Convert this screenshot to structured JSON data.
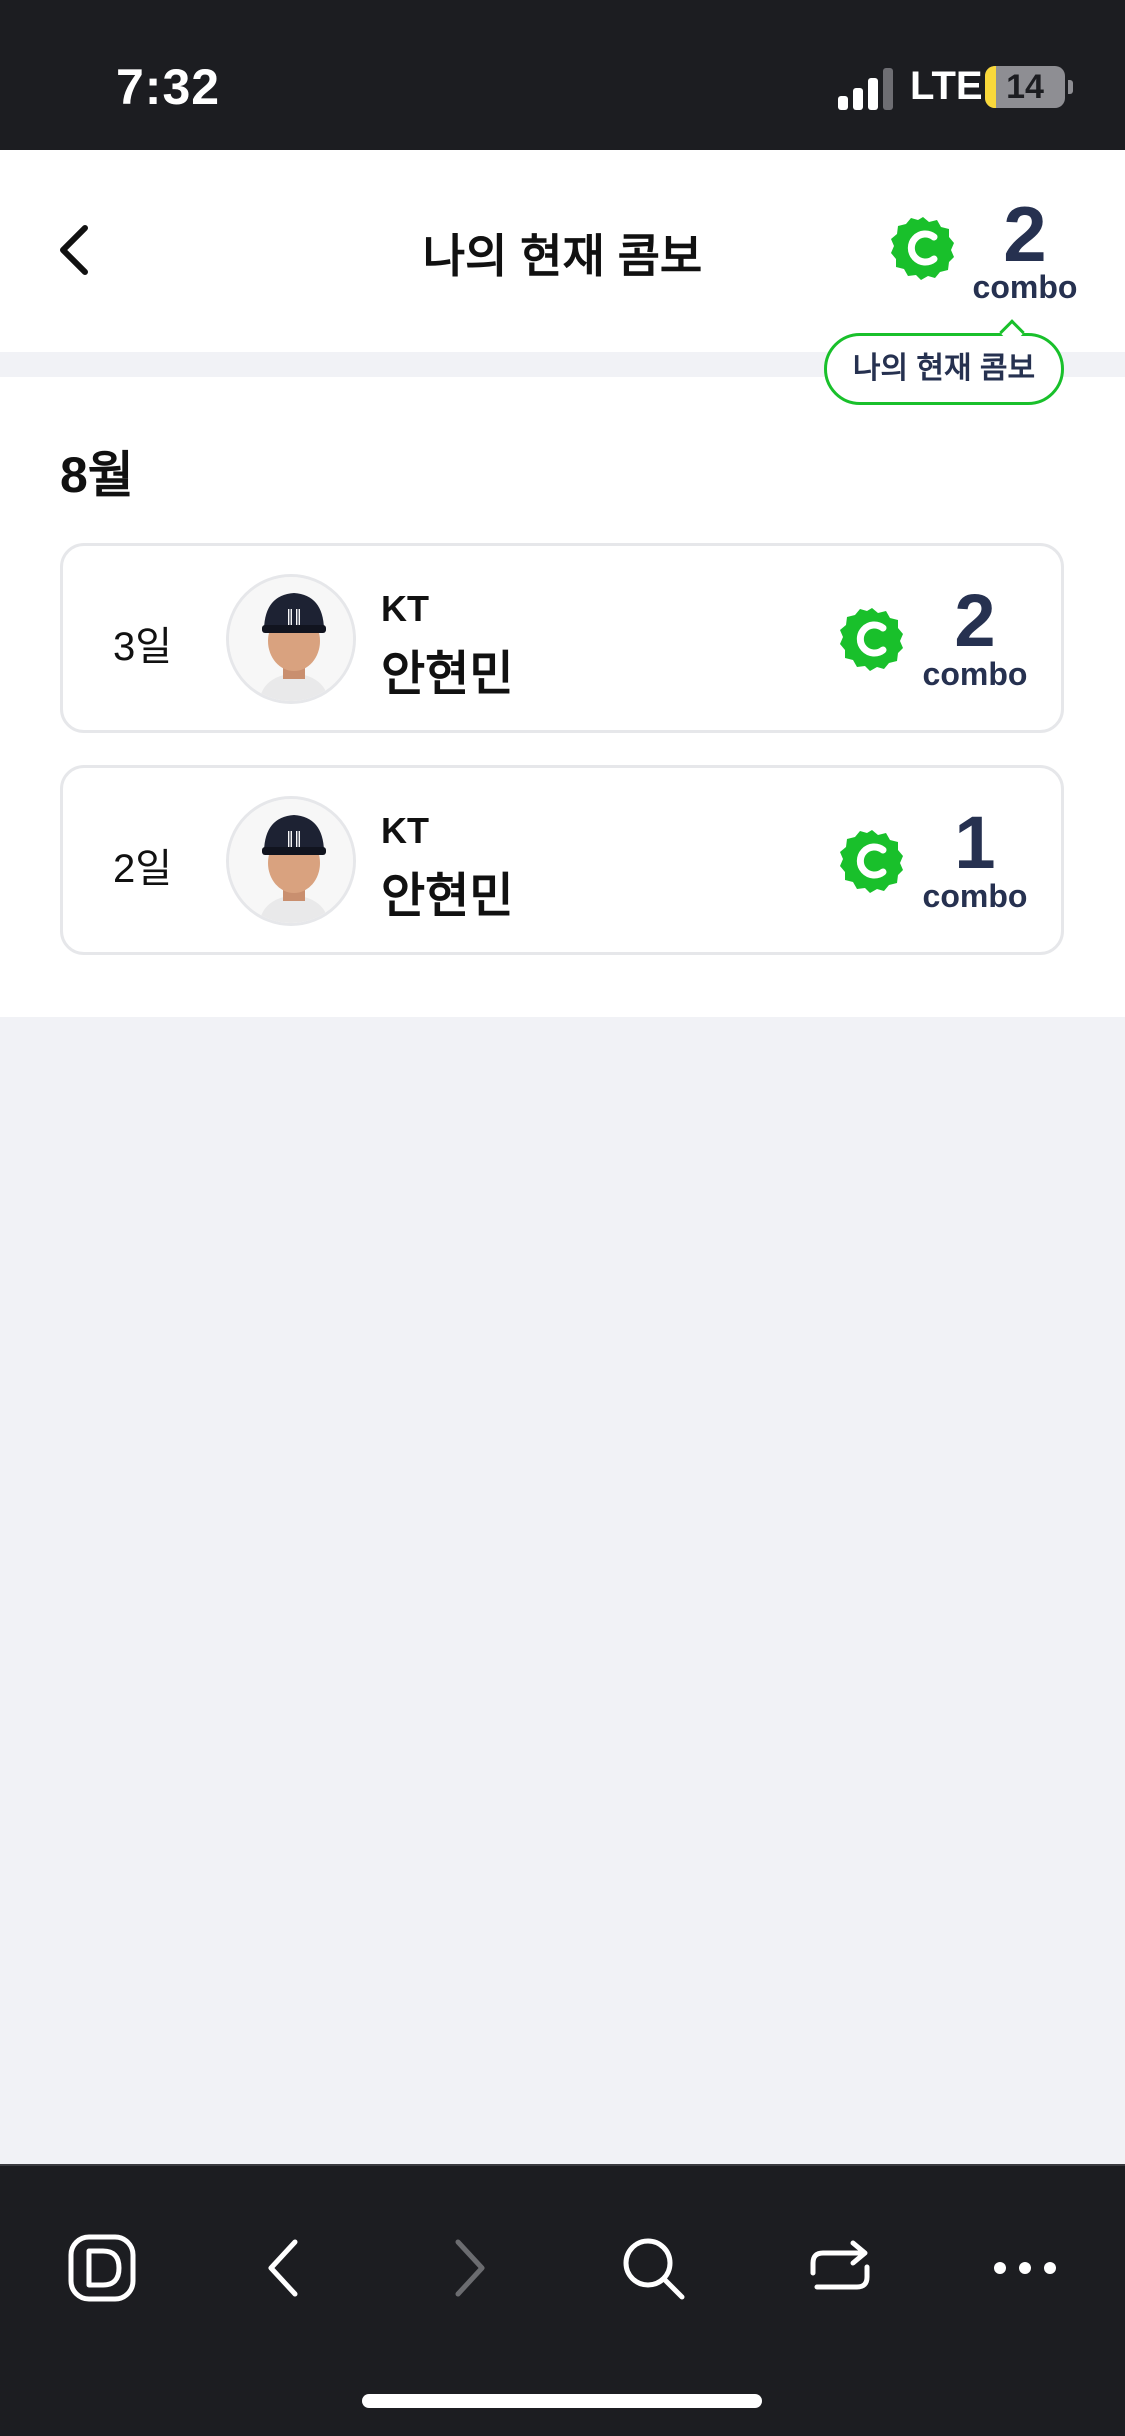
{
  "status_bar": {
    "time": "7:32",
    "network": "LTE",
    "battery_level": "14",
    "battery_fraction": 0.14
  },
  "header": {
    "title": "나의 현재 콤보",
    "combo_count": "2",
    "combo_label": "combo",
    "tooltip": "나의 현재 콤보",
    "back_icon": "chevron-left-icon",
    "combo_icon": "combo-badge-icon"
  },
  "history": {
    "month": "8월",
    "entries": [
      {
        "day": "3일",
        "team": "KT",
        "player": "안현민",
        "combo_count": "2",
        "combo_label": "combo"
      },
      {
        "day": "2일",
        "team": "KT",
        "player": "안현민",
        "combo_count": "1",
        "combo_label": "combo"
      }
    ]
  },
  "toolbar": {
    "icons": [
      "app-logo-icon",
      "back-icon",
      "forward-icon",
      "search-icon",
      "share-icon",
      "more-icon"
    ]
  },
  "colors": {
    "accent_green": "#19c02b",
    "combo_navy": "#263150",
    "dark_bg": "#1c1d21",
    "page_bg": "#f1f2f6"
  }
}
